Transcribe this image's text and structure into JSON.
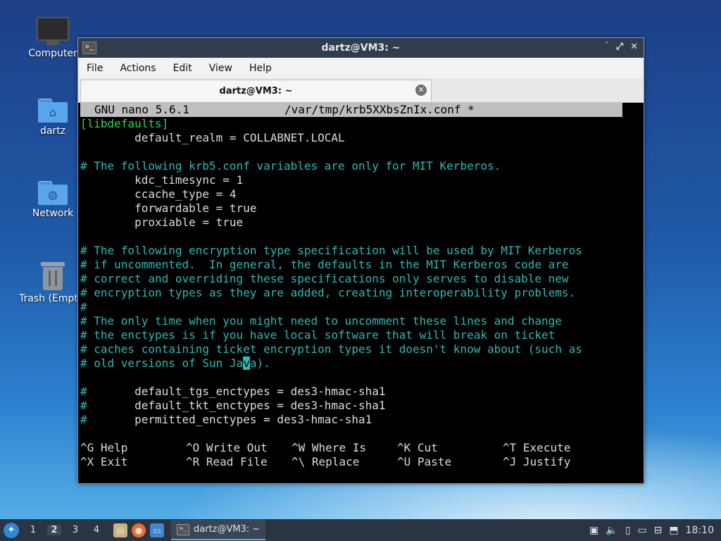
{
  "desktop": {
    "icons": [
      {
        "label": "Computer"
      },
      {
        "label": "dartz"
      },
      {
        "label": "Network"
      },
      {
        "label": "Trash (Empty)"
      }
    ]
  },
  "window": {
    "title": "dartz@VM3: ~",
    "controls": {
      "minimize": "˙",
      "maximize": "⤢",
      "close": "✕"
    },
    "menu": [
      "File",
      "Actions",
      "Edit",
      "View",
      "Help"
    ],
    "tab_label": "dartz@VM3: ~",
    "tab_close": "✕"
  },
  "nano": {
    "header_app": "GNU nano 5.6.1",
    "header_file": "/var/tmp/krb5XXbsZnIx.conf *",
    "lines": [
      "[libdefaults]",
      "        default_realm = COLLABNET.LOCAL",
      "",
      "# The following krb5.conf variables are only for MIT Kerberos.",
      "        kdc_timesync = 1",
      "        ccache_type = 4",
      "        forwardable = true",
      "        proxiable = true",
      "",
      "# The following encryption type specification will be used by MIT Kerberos",
      "# if uncommented.  In general, the defaults in the MIT Kerberos code are",
      "# correct and overriding these specifications only serves to disable new",
      "# encryption types as they are added, creating interoperability problems.",
      "#",
      "# The only time when you might need to uncomment these lines and change",
      "# the enctypes is if you have local software that will break on ticket",
      "# caches containing ticket encryption types it doesn't know about (such as",
      "# old versions of Sun Java).",
      "",
      "#       default_tgs_enctypes = des3-hmac-sha1",
      "#       default_tkt_enctypes = des3-hmac-sha1",
      "#       permitted_enctypes = des3-hmac-sha1"
    ],
    "shortcuts": [
      {
        "key": "^G",
        "label": "Help"
      },
      {
        "key": "^O",
        "label": "Write Out"
      },
      {
        "key": "^W",
        "label": "Where Is"
      },
      {
        "key": "^K",
        "label": "Cut"
      },
      {
        "key": "^T",
        "label": "Execute"
      },
      {
        "key": "^X",
        "label": "Exit"
      },
      {
        "key": "^R",
        "label": "Read File"
      },
      {
        "key": "^\\",
        "label": "Replace"
      },
      {
        "key": "^U",
        "label": "Paste"
      },
      {
        "key": "^J",
        "label": "Justify"
      }
    ]
  },
  "taskbar": {
    "workspaces": [
      "1",
      "2",
      "3",
      "4"
    ],
    "active_workspace": "2",
    "task_label": "dartz@VM3: ~",
    "clock": "18:10"
  },
  "colors": {
    "comment": "#2fb7b4",
    "section": "#2fd35a",
    "header_bg": "#bfbfbf"
  }
}
